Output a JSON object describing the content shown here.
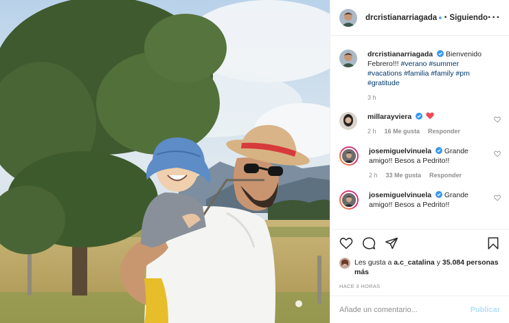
{
  "post": {
    "author": "drcristianarriagada",
    "separator": "•",
    "follow_status": "Siguiendo",
    "more_icon": "more-options-icon",
    "caption_text": "Bienvenido Febrero!!!",
    "hashtags": "#verano #summer #vacations #familia #family #pm #gratitude",
    "caption_time": "3 h"
  },
  "comments": [
    {
      "user": "millarayviera",
      "text": "",
      "emoji": "red-heart",
      "time": "2 h",
      "likes": "16 Me gusta",
      "reply": "Responder"
    },
    {
      "user": "josemiguelvinuela",
      "text": "Grande amigo!! Besos a Pedrito!!",
      "time": "2 h",
      "likes": "33 Me gusta",
      "reply": "Responder"
    },
    {
      "user": "josemiguelvinuela",
      "text": "Grande amigo!! Besos a Pedrito!!"
    }
  ],
  "actions": {
    "likes_prefix": "Les gusta a",
    "likes_user": "a.c_catalina",
    "likes_connector": "y",
    "likes_count": "35.084 personas",
    "likes_suffix": "más",
    "timestamp": "HACE 3 HORAS"
  },
  "add_comment": {
    "placeholder": "Añade un comentario...",
    "publish_label": "Publicar"
  },
  "colors": {
    "verified": "#3897f0",
    "link": "#00376b",
    "heart": "#ed4956",
    "publish_disabled": "#b2dffc"
  }
}
